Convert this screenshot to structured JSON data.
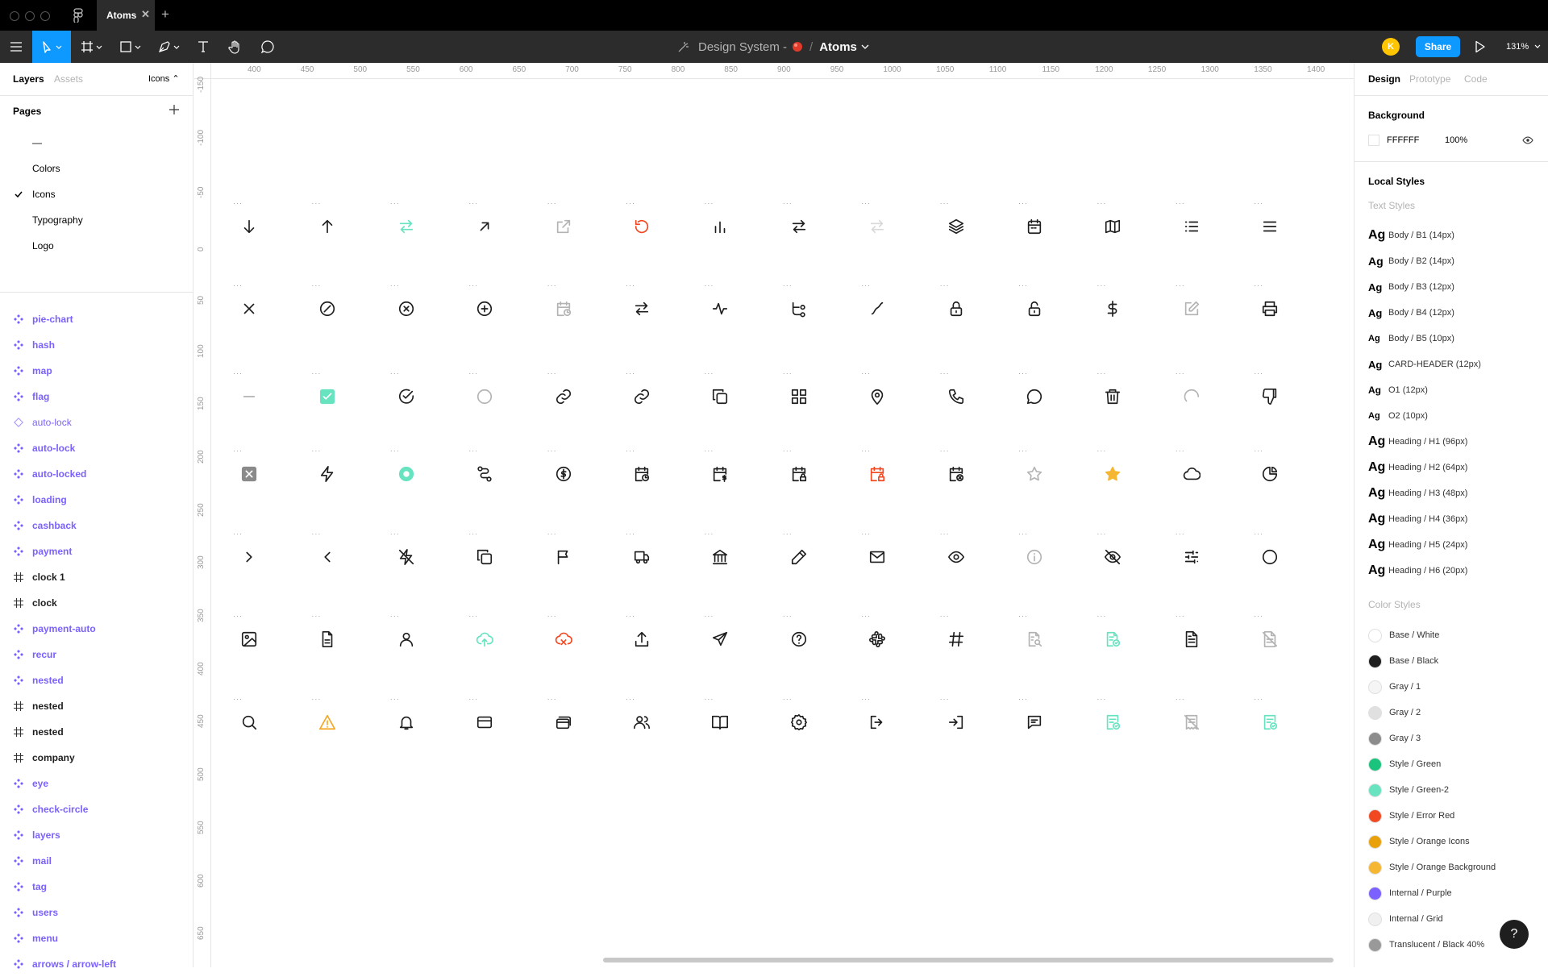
{
  "tabbar": {
    "doc_tab": "Atoms",
    "close": "✕",
    "new_tab": "+"
  },
  "toolbar": {
    "file_title": "Design System -",
    "separator": "/",
    "page": "Atoms",
    "avatar_initial": "K",
    "share": "Share",
    "zoom": "131%"
  },
  "left": {
    "tabs": [
      "Layers",
      "Assets"
    ],
    "page_picker": "Icons ⌃",
    "pages_title": "Pages",
    "pages": [
      {
        "name": "—",
        "checked": false
      },
      {
        "name": "Colors",
        "checked": false
      },
      {
        "name": "Icons",
        "checked": true
      },
      {
        "name": "Typography",
        "checked": false
      },
      {
        "name": "Logo",
        "checked": false
      }
    ],
    "layers": [
      {
        "name": "pie-chart",
        "kind": "comp"
      },
      {
        "name": "hash",
        "kind": "comp"
      },
      {
        "name": "map",
        "kind": "comp"
      },
      {
        "name": "flag",
        "kind": "comp"
      },
      {
        "name": "auto-lock",
        "kind": "instance"
      },
      {
        "name": "auto-lock",
        "kind": "comp"
      },
      {
        "name": "auto-locked",
        "kind": "comp"
      },
      {
        "name": "loading",
        "kind": "comp"
      },
      {
        "name": "cashback",
        "kind": "comp"
      },
      {
        "name": "payment",
        "kind": "comp"
      },
      {
        "name": "clock 1",
        "kind": "frame"
      },
      {
        "name": "clock",
        "kind": "frame"
      },
      {
        "name": "payment-auto",
        "kind": "comp"
      },
      {
        "name": "recur",
        "kind": "comp"
      },
      {
        "name": "nested",
        "kind": "comp"
      },
      {
        "name": "nested",
        "kind": "frame"
      },
      {
        "name": "nested",
        "kind": "frame"
      },
      {
        "name": "company",
        "kind": "frame"
      },
      {
        "name": "eye",
        "kind": "comp"
      },
      {
        "name": "check-circle",
        "kind": "comp"
      },
      {
        "name": "layers",
        "kind": "comp"
      },
      {
        "name": "mail",
        "kind": "comp"
      },
      {
        "name": "tag",
        "kind": "comp"
      },
      {
        "name": "users",
        "kind": "comp"
      },
      {
        "name": "menu",
        "kind": "comp"
      },
      {
        "name": "arrows / arrow-left",
        "kind": "comp"
      }
    ]
  },
  "rulers": {
    "top": [
      "400",
      "450",
      "500",
      "550",
      "600",
      "650",
      "700",
      "750",
      "800",
      "850",
      "900",
      "950",
      "1000",
      "1050",
      "1100",
      "1150",
      "1200",
      "1250",
      "1300",
      "1350",
      "1400"
    ],
    "left": [
      "-150",
      "-100",
      "-50",
      "0",
      "50",
      "100",
      "150",
      "200",
      "250",
      "300",
      "350",
      "400",
      "450",
      "500",
      "550",
      "600",
      "650"
    ]
  },
  "canvas": {
    "rows": [
      [
        {
          "n": "arrow-down-icon",
          "c": "#1e1e1e"
        },
        {
          "n": "arrow-up-icon",
          "c": "#1e1e1e"
        },
        {
          "n": "arrows-swap-icon",
          "c": "#67e3c0"
        },
        {
          "n": "arrow-up-right-icon",
          "c": "#1e1e1e"
        },
        {
          "n": "external-link-icon",
          "c": "#b3b3b3"
        },
        {
          "n": "refresh-icon",
          "c": "#f24822"
        },
        {
          "n": "bar-chart-icon",
          "c": "#1e1e1e"
        },
        {
          "n": "arrows-swap-icon",
          "c": "#1e1e1e"
        },
        {
          "n": "arrows-swap-icon",
          "c": "#d9d9d9"
        },
        {
          "n": "layers-icon",
          "c": "#1e1e1e"
        },
        {
          "n": "calendar-icon",
          "c": "#1e1e1e"
        },
        {
          "n": "map-icon",
          "c": "#1e1e1e"
        },
        {
          "n": "list-icon",
          "c": "#1e1e1e"
        },
        {
          "n": "menu-icon",
          "c": "#1e1e1e"
        }
      ],
      [
        {
          "n": "close-icon",
          "c": "#1e1e1e"
        },
        {
          "n": "slash-circle-icon",
          "c": "#1e1e1e"
        },
        {
          "n": "x-circle-icon",
          "c": "#1e1e1e"
        },
        {
          "n": "plus-circle-icon",
          "c": "#1e1e1e"
        },
        {
          "n": "calendar-clock-icon",
          "c": "#b3b3b3"
        },
        {
          "n": "arrows-swap-icon",
          "c": "#1e1e1e"
        },
        {
          "n": "activity-icon",
          "c": "#1e1e1e"
        },
        {
          "n": "nested-icon",
          "c": "#1e1e1e"
        },
        {
          "n": "trend-icon",
          "c": "#1e1e1e"
        },
        {
          "n": "auto-lock-icon",
          "c": "#1e1e1e"
        },
        {
          "n": "lock-icon",
          "c": "#1e1e1e"
        },
        {
          "n": "dollar-icon",
          "c": "#1e1e1e"
        },
        {
          "n": "edit-icon",
          "c": "#b3b3b3"
        },
        {
          "n": "printer-icon",
          "c": "#1e1e1e"
        }
      ],
      [
        {
          "n": "minus-icon",
          "c": "#b3b3b3"
        },
        {
          "n": "checkbox-checked-icon",
          "c": "#67e3c0"
        },
        {
          "n": "check-circle-icon",
          "c": "#1e1e1e"
        },
        {
          "n": "circle-icon",
          "c": "#b3b3b3"
        },
        {
          "n": "link-icon",
          "c": "#1e1e1e"
        },
        {
          "n": "link-icon",
          "c": "#1e1e1e"
        },
        {
          "n": "copy-icon",
          "c": "#1e1e1e"
        },
        {
          "n": "grid-icon",
          "c": "#1e1e1e"
        },
        {
          "n": "map-pin-icon",
          "c": "#1e1e1e"
        },
        {
          "n": "phone-icon",
          "c": "#1e1e1e"
        },
        {
          "n": "chat-icon",
          "c": "#1e1e1e"
        },
        {
          "n": "trash-icon",
          "c": "#1e1e1e"
        },
        {
          "n": "loading-icon",
          "c": "#b3b3b3"
        },
        {
          "n": "thumbs-down-icon",
          "c": "#1e1e1e"
        }
      ],
      [
        {
          "n": "checkbox-x-icon",
          "c": "#8a8a8a"
        },
        {
          "n": "zap-icon",
          "c": "#1e1e1e"
        },
        {
          "n": "radio-icon",
          "c": "#67e3c0"
        },
        {
          "n": "route-icon",
          "c": "#1e1e1e"
        },
        {
          "n": "cashback-icon",
          "c": "#1e1e1e"
        },
        {
          "n": "calendar-clock-icon",
          "c": "#1e1e1e"
        },
        {
          "n": "calendar-dollar-icon",
          "c": "#1e1e1e"
        },
        {
          "n": "calendar-lock-icon",
          "c": "#1e1e1e"
        },
        {
          "n": "calendar-lock-icon",
          "c": "#f24822"
        },
        {
          "n": "calendar-x-icon",
          "c": "#1e1e1e"
        },
        {
          "n": "star-icon",
          "c": "#b3b3b3"
        },
        {
          "n": "star-filled-icon",
          "c": "#f5b731"
        },
        {
          "n": "cloud-icon",
          "c": "#1e1e1e"
        },
        {
          "n": "pie-chart-icon",
          "c": "#1e1e1e"
        }
      ],
      [
        {
          "n": "chevron-right-icon",
          "c": "#1e1e1e"
        },
        {
          "n": "chevron-left-icon",
          "c": "#1e1e1e"
        },
        {
          "n": "zap-off-icon",
          "c": "#1e1e1e"
        },
        {
          "n": "copy-icon",
          "c": "#1e1e1e"
        },
        {
          "n": "flag-icon",
          "c": "#1e1e1e"
        },
        {
          "n": "truck-icon",
          "c": "#1e1e1e"
        },
        {
          "n": "bank-icon",
          "c": "#1e1e1e"
        },
        {
          "n": "pencil-icon",
          "c": "#1e1e1e"
        },
        {
          "n": "mail-icon",
          "c": "#1e1e1e"
        },
        {
          "n": "eye-icon",
          "c": "#1e1e1e"
        },
        {
          "n": "info-icon",
          "c": "#b3b3b3"
        },
        {
          "n": "eye-off-icon",
          "c": "#1e1e1e"
        },
        {
          "n": "sliders-icon",
          "c": "#1e1e1e"
        },
        {
          "n": "circle-icon",
          "c": "#1e1e1e"
        }
      ],
      [
        {
          "n": "image-icon",
          "c": "#1e1e1e"
        },
        {
          "n": "file-icon",
          "c": "#1e1e1e"
        },
        {
          "n": "user-icon",
          "c": "#1e1e1e"
        },
        {
          "n": "cloud-upload-icon",
          "c": "#67e3c0"
        },
        {
          "n": "cloud-off-icon",
          "c": "#f24822"
        },
        {
          "n": "upload-icon",
          "c": "#1e1e1e"
        },
        {
          "n": "send-icon",
          "c": "#1e1e1e"
        },
        {
          "n": "help-circle-icon",
          "c": "#1e1e1e"
        },
        {
          "n": "slack-icon",
          "c": "#1e1e1e"
        },
        {
          "n": "hash-icon",
          "c": "#1e1e1e"
        },
        {
          "n": "file-search-icon",
          "c": "#b3b3b3"
        },
        {
          "n": "file-check-icon",
          "c": "#67e3c0"
        },
        {
          "n": "file-text-icon",
          "c": "#1e1e1e"
        },
        {
          "n": "file-off-icon",
          "c": "#b3b3b3"
        }
      ],
      [
        {
          "n": "search-icon",
          "c": "#1e1e1e"
        },
        {
          "n": "alert-triangle-icon",
          "c": "#f5a623"
        },
        {
          "n": "bell-icon",
          "c": "#1e1e1e"
        },
        {
          "n": "credit-card-icon",
          "c": "#1e1e1e"
        },
        {
          "n": "cards-icon",
          "c": "#1e1e1e"
        },
        {
          "n": "users-icon",
          "c": "#1e1e1e"
        },
        {
          "n": "book-open-icon",
          "c": "#1e1e1e"
        },
        {
          "n": "gear-icon",
          "c": "#1e1e1e"
        },
        {
          "n": "logout-icon",
          "c": "#1e1e1e"
        },
        {
          "n": "login-icon",
          "c": "#1e1e1e"
        },
        {
          "n": "message-icon",
          "c": "#1e1e1e"
        },
        {
          "n": "receipt-check-icon",
          "c": "#67e3c0"
        },
        {
          "n": "receipt-off-icon",
          "c": "#b3b3b3"
        },
        {
          "n": "receipt-check-icon",
          "c": "#67e3c0"
        }
      ]
    ]
  },
  "right": {
    "tabs": [
      "Design",
      "Prototype",
      "Code"
    ],
    "background_title": "Background",
    "bg_hex": "FFFFFF",
    "bg_opacity": "100%",
    "local_styles": "Local Styles",
    "text_styles_title": "Text Styles",
    "text_styles": [
      {
        "name": "Body / B1 (14px)"
      },
      {
        "name": "Body / B2 (14px)"
      },
      {
        "name": "Body / B3 (12px)"
      },
      {
        "name": "Body / B4 (12px)"
      },
      {
        "name": "Body / B5 (10px)"
      },
      {
        "name": "CARD-HEADER (12px)"
      },
      {
        "name": "O1 (12px)"
      },
      {
        "name": "O2 (10px)"
      },
      {
        "name": "Heading / H1 (96px)"
      },
      {
        "name": "Heading / H2 (64px)"
      },
      {
        "name": "Heading / H3 (48px)"
      },
      {
        "name": "Heading / H4 (36px)"
      },
      {
        "name": "Heading / H5 (24px)"
      },
      {
        "name": "Heading / H6 (20px)"
      }
    ],
    "ag": "Ag",
    "color_styles_title": "Color Styles",
    "color_styles": [
      {
        "name": "Base / White",
        "color": "#ffffff"
      },
      {
        "name": "Base / Black",
        "color": "#1e1e1e"
      },
      {
        "name": "Gray / 1",
        "color": "#f5f5f5"
      },
      {
        "name": "Gray / 2",
        "color": "#e0e0e0"
      },
      {
        "name": "Gray / 3",
        "color": "#8c8c8c"
      },
      {
        "name": "Style / Green",
        "color": "#1bc47d"
      },
      {
        "name": "Style / Green-2",
        "color": "#67e3c0"
      },
      {
        "name": "Style / Error Red",
        "color": "#f24822"
      },
      {
        "name": "Style / Orange Icons",
        "color": "#e8a10a"
      },
      {
        "name": "Style / Orange Background",
        "color": "#f5b731"
      },
      {
        "name": "Internal / Purple",
        "color": "#7b61ff"
      },
      {
        "name": "Internal / Grid",
        "color": "#f0f0f0"
      },
      {
        "name": "Translucent / Black 40%",
        "color": "#999999"
      }
    ],
    "help": "?"
  }
}
